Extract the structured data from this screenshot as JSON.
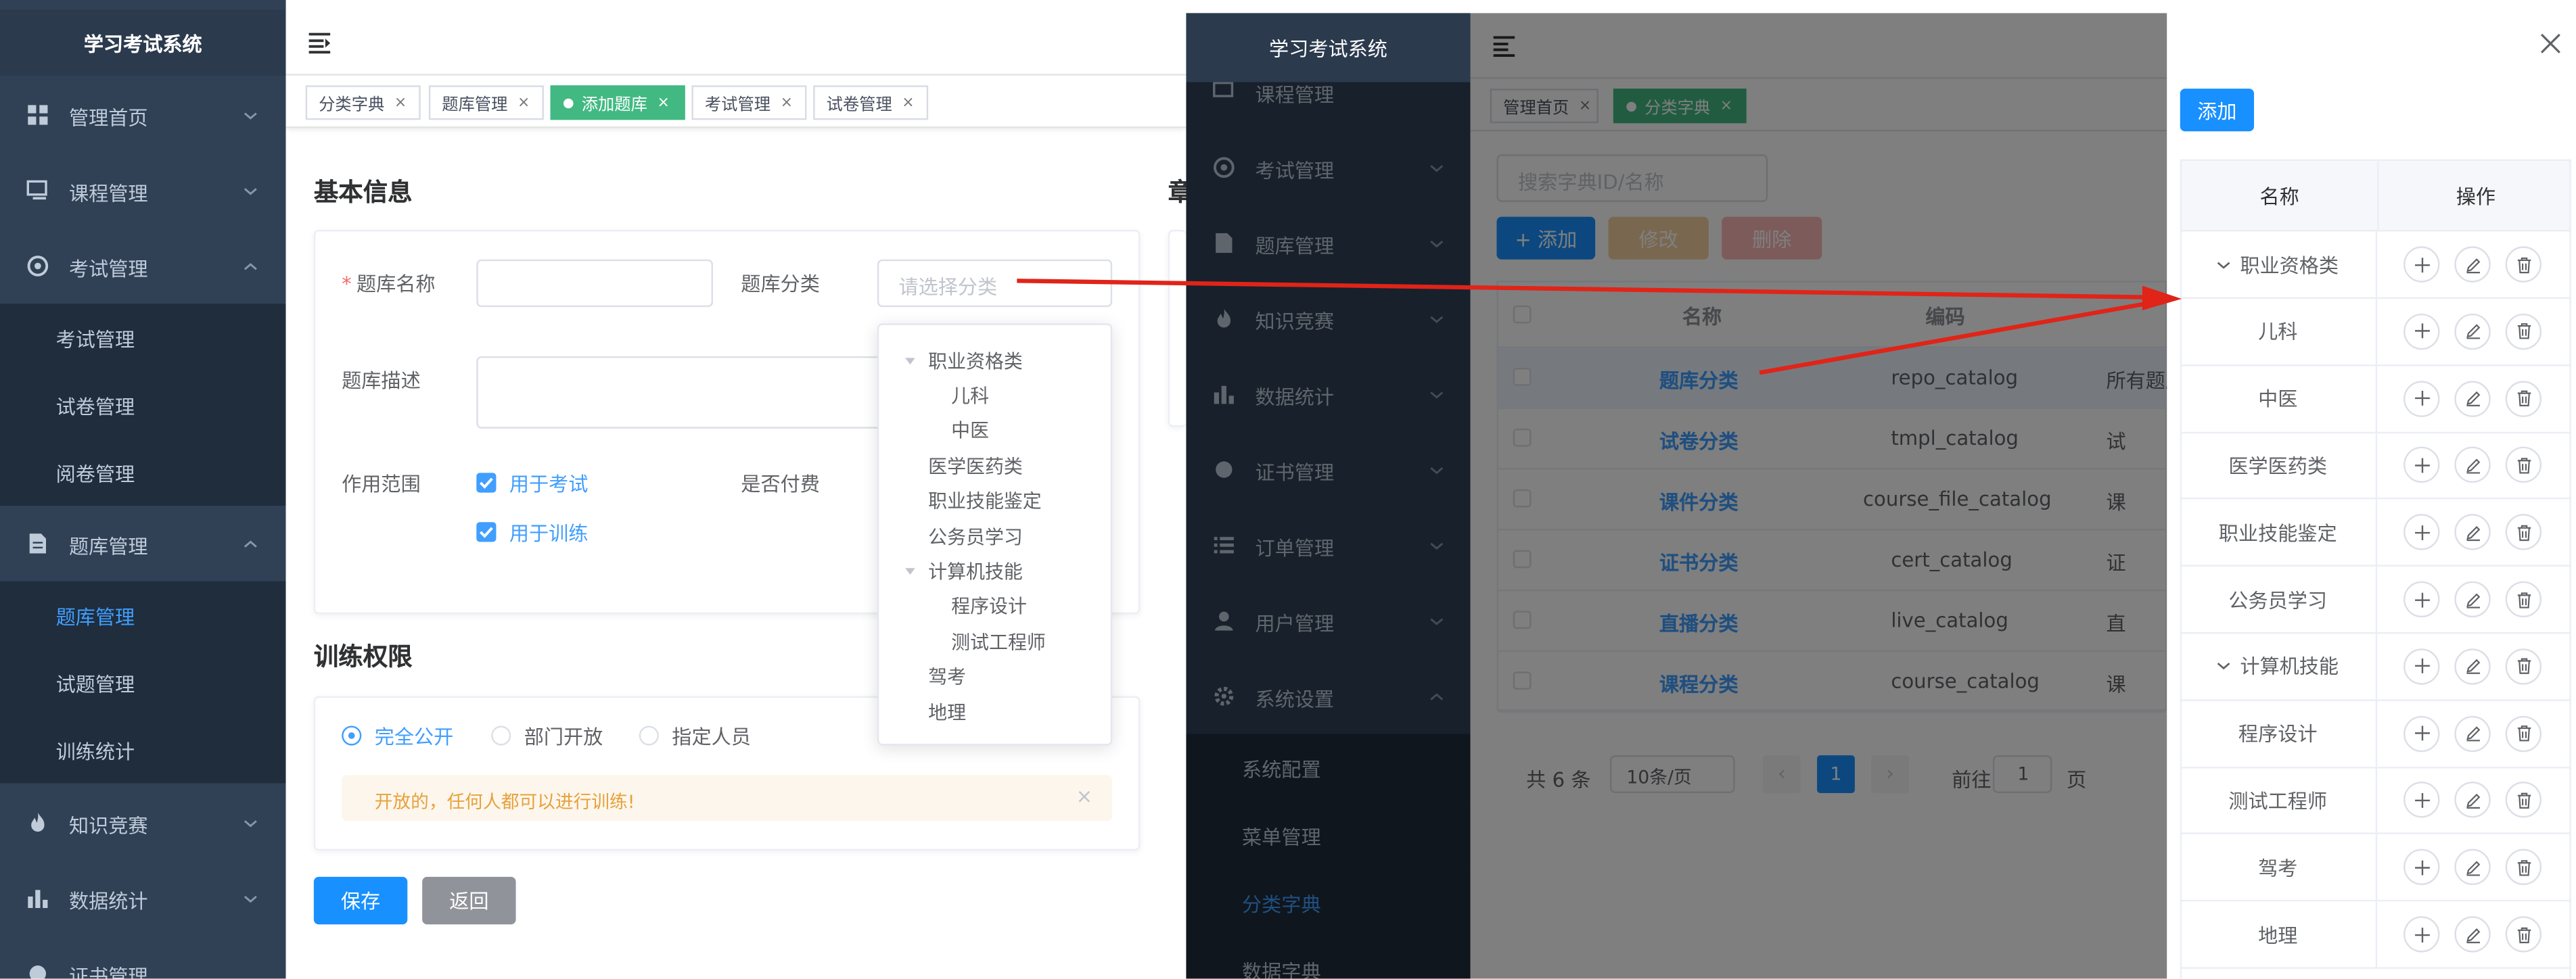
{
  "left_app": {
    "logo": "学习考试系统",
    "menu": [
      {
        "label": "管理首页",
        "icon": "dashboard-icon"
      },
      {
        "label": "课程管理",
        "icon": "monitor-icon"
      },
      {
        "label": "考试管理",
        "icon": "target-icon"
      },
      {
        "label": "题库管理",
        "icon": "document-icon"
      },
      {
        "label": "知识竞赛",
        "icon": "fire-icon"
      },
      {
        "label": "数据统计",
        "icon": "bar-chart-icon"
      },
      {
        "label": "证书管理",
        "icon": "certificate-icon"
      }
    ],
    "exam_sub": [
      "考试管理",
      "试卷管理",
      "阅卷管理"
    ],
    "repo_sub": [
      "题库管理",
      "试题管理",
      "训练统计"
    ],
    "tabs": [
      "分类字典",
      "题库管理",
      "添加题库",
      "考试管理",
      "试卷管理"
    ],
    "section_basic": "基本信息",
    "section_side": "章",
    "form": {
      "name_label": "题库名称",
      "category_label": "题库分类",
      "category_placeholder": "请选择分类",
      "desc_label": "题库描述",
      "scope_label": "作用范围",
      "scope_exam": "用于考试",
      "scope_train": "用于训练",
      "paid_label": "是否付费"
    },
    "dropdown": [
      {
        "label": "职业资格类",
        "expanded": true
      },
      {
        "label": "儿科"
      },
      {
        "label": "中医"
      },
      {
        "label": "医学医药类"
      },
      {
        "label": "职业技能鉴定"
      },
      {
        "label": "公务员学习"
      },
      {
        "label": "计算机技能",
        "expanded": true
      },
      {
        "label": "程序设计"
      },
      {
        "label": "测试工程师"
      },
      {
        "label": "驾考"
      },
      {
        "label": "地理"
      }
    ],
    "section_train": "训练权限",
    "radios": [
      "完全公开",
      "部门开放",
      "指定人员"
    ],
    "alert": "开放的，任何人都可以进行训练!",
    "btn_save": "保存",
    "btn_back": "返回"
  },
  "right_app": {
    "logo": "学习考试系统",
    "menu": [
      {
        "label": "课程管理",
        "icon": "monitor-icon"
      },
      {
        "label": "考试管理",
        "icon": "target-icon"
      },
      {
        "label": "题库管理",
        "icon": "document-icon"
      },
      {
        "label": "知识竞赛",
        "icon": "fire-icon"
      },
      {
        "label": "数据统计",
        "icon": "bar-chart-icon"
      },
      {
        "label": "证书管理",
        "icon": "certificate-icon"
      },
      {
        "label": "订单管理",
        "icon": "list-icon"
      },
      {
        "label": "用户管理",
        "icon": "user-icon"
      },
      {
        "label": "系统设置",
        "icon": "gear-icon"
      }
    ],
    "settings_sub": [
      "系统配置",
      "菜单管理",
      "分类字典",
      "数据字典"
    ],
    "tabs": [
      "管理首页",
      "分类字典"
    ],
    "search_placeholder": "搜索字典ID/名称",
    "btn_add": "+ 添加",
    "btn_edit": "修改",
    "btn_delete": "删除",
    "table": {
      "headers": [
        "名称",
        "编码"
      ],
      "rows": [
        {
          "name": "题库分类",
          "code": "repo_catalog",
          "extra": "所有题库"
        },
        {
          "name": "试卷分类",
          "code": "tmpl_catalog",
          "extra": "试"
        },
        {
          "name": "课件分类",
          "code": "course_file_catalog",
          "extra": "课"
        },
        {
          "name": "证书分类",
          "code": "cert_catalog",
          "extra": "证"
        },
        {
          "name": "直播分类",
          "code": "live_catalog",
          "extra": "直"
        },
        {
          "name": "课程分类",
          "code": "course_catalog",
          "extra": "课"
        }
      ]
    },
    "pagination": {
      "total": "共 6 条",
      "size": "10条/页",
      "page": "1",
      "goto": "前往",
      "goto_value": "1",
      "page_unit": "页"
    }
  },
  "drawer": {
    "btn_add": "添加",
    "headers": [
      "名称",
      "操作"
    ],
    "rows": [
      {
        "label": "职业资格类",
        "expanded": true
      },
      {
        "label": "儿科"
      },
      {
        "label": "中医"
      },
      {
        "label": "医学医药类"
      },
      {
        "label": "职业技能鉴定"
      },
      {
        "label": "公务员学习"
      },
      {
        "label": "计算机技能",
        "expanded": true
      },
      {
        "label": "程序设计"
      },
      {
        "label": "测试工程师"
      },
      {
        "label": "驾考"
      },
      {
        "label": "地理"
      }
    ]
  },
  "colors": {
    "primary": "#409eff",
    "sidebar": "#304156",
    "arrow": "#e02418",
    "tag_active": "#42b983"
  }
}
